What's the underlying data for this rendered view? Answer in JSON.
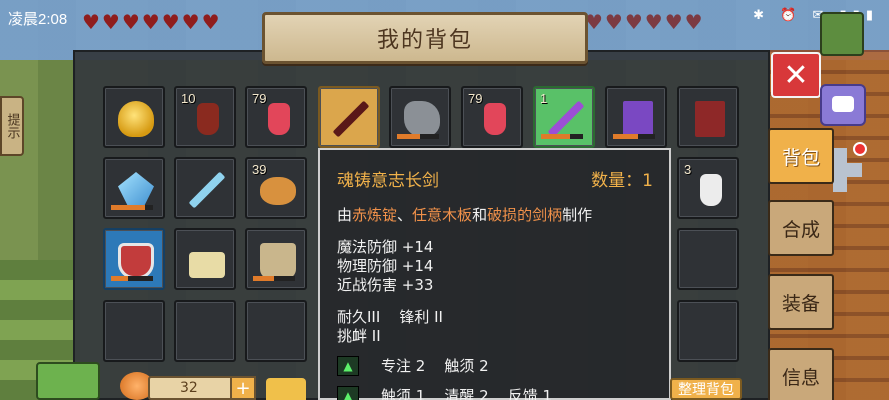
{
  "status_bar": {
    "time": "凌晨2:08",
    "icons_text": "✱ ⏰ ✉ ▮▮▮"
  },
  "title": "我的背包",
  "close_label": "✕",
  "tabs": [
    {
      "label": "背包",
      "active": true
    },
    {
      "label": "合成",
      "active": false
    },
    {
      "label": "装备",
      "active": false
    },
    {
      "label": "信息",
      "active": false
    }
  ],
  "left_tab": "提示",
  "inventory": {
    "row1": [
      {
        "item": "gold-ingot",
        "qty": ""
      },
      {
        "item": "wine-bottle",
        "qty": "10"
      },
      {
        "item": "red-potion",
        "qty": "79"
      },
      {
        "item": "soulforged-sword",
        "qty": "",
        "selected": true
      },
      {
        "item": "ore-stone",
        "qty": ""
      },
      {
        "item": "red-potion",
        "qty": "79"
      },
      {
        "item": "magic-staff",
        "qty": "1",
        "highlight": "green"
      },
      {
        "item": "purple-book",
        "qty": ""
      },
      {
        "item": "red-book",
        "qty": ""
      }
    ],
    "row2": [
      {
        "item": "crystal-axe",
        "qty": ""
      },
      {
        "item": "ice-sword",
        "qty": ""
      },
      {
        "item": "bread",
        "qty": "39"
      }
    ],
    "row2_right": {
      "item": "white-bottle",
      "qty": "3"
    },
    "row3": [
      {
        "item": "shield",
        "qty": "",
        "highlight": "blue"
      },
      {
        "item": "boots",
        "qty": ""
      },
      {
        "item": "armor",
        "qty": ""
      }
    ]
  },
  "tooltip": {
    "name": "魂铸意志长剑",
    "count_label": "数量：",
    "count": "1",
    "recipe": {
      "prefix": "由",
      "mat1": "赤炼锭",
      "sep1": "、",
      "mat2": "任意木板",
      "sep2": "和",
      "mat3": "破损的剑柄",
      "suffix": "制作"
    },
    "stats": [
      "魔法防御 +14",
      "物理防御 +14",
      "近战伤害 +33"
    ],
    "enchant_line1": "耐久III    锋利 II",
    "enchant_line2": "挑衅 II",
    "skills": [
      "专注 2    触须 2",
      "触须 1    清醒 2    反馈 1"
    ]
  },
  "bottom": {
    "coins": "32",
    "plus_label": "+",
    "sort_button": "整理背包"
  }
}
